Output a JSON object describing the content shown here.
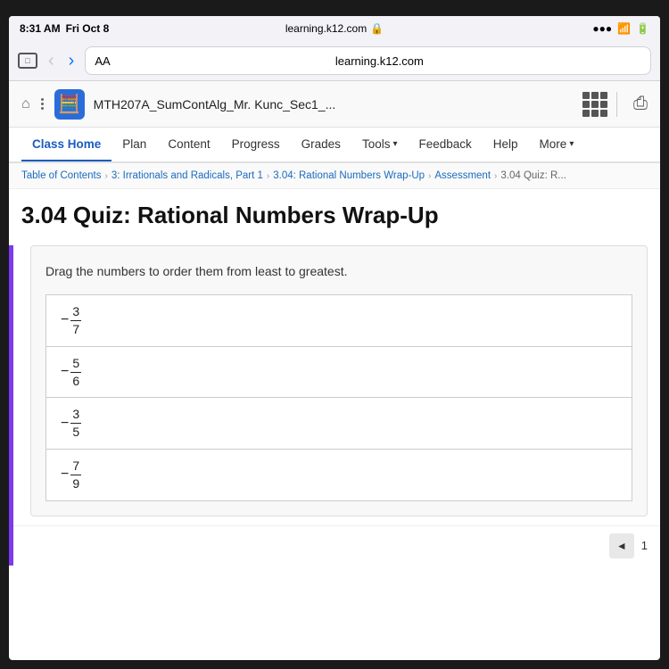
{
  "status_bar": {
    "time": "8:31 AM",
    "date": "Fri Oct 8",
    "url": "learning.k12.com",
    "lock": "🔒"
  },
  "browser": {
    "aa_label": "AA",
    "back_btn": "‹",
    "forward_btn": "›"
  },
  "page_toolbar": {
    "home_icon": "⌂",
    "course_icon": "▦",
    "course_title": "MTH207A_SumContAlg_Mr. Kunc_Sec1_...",
    "share_icon": "⎙"
  },
  "nav_menu": {
    "items": [
      {
        "label": "Class Home",
        "active": true
      },
      {
        "label": "Plan",
        "active": false
      },
      {
        "label": "Content",
        "active": false
      },
      {
        "label": "Progress",
        "active": false
      },
      {
        "label": "Grades",
        "active": false
      },
      {
        "label": "Tools",
        "active": false,
        "has_chevron": true
      },
      {
        "label": "Feedback",
        "active": false
      },
      {
        "label": "Help",
        "active": false
      },
      {
        "label": "More",
        "active": false,
        "has_chevron": true
      }
    ]
  },
  "breadcrumb": {
    "items": [
      "Table of Contents",
      "3: Irrationals and Radicals, Part 1",
      "3.04: Rational Numbers Wrap-Up",
      "Assessment",
      "3.04 Quiz: R..."
    ]
  },
  "page": {
    "title": "3.04 Quiz: Rational Numbers Wrap-Up",
    "instruction": "Drag the numbers to order them from least to greatest.",
    "fractions": [
      {
        "neg": true,
        "numerator": "3",
        "denominator": "7"
      },
      {
        "neg": true,
        "numerator": "5",
        "denominator": "6"
      },
      {
        "neg": true,
        "numerator": "3",
        "denominator": "5"
      },
      {
        "neg": true,
        "numerator": "7",
        "denominator": "9"
      }
    ]
  },
  "pagination": {
    "prev_label": "◄",
    "page_number": "1"
  }
}
